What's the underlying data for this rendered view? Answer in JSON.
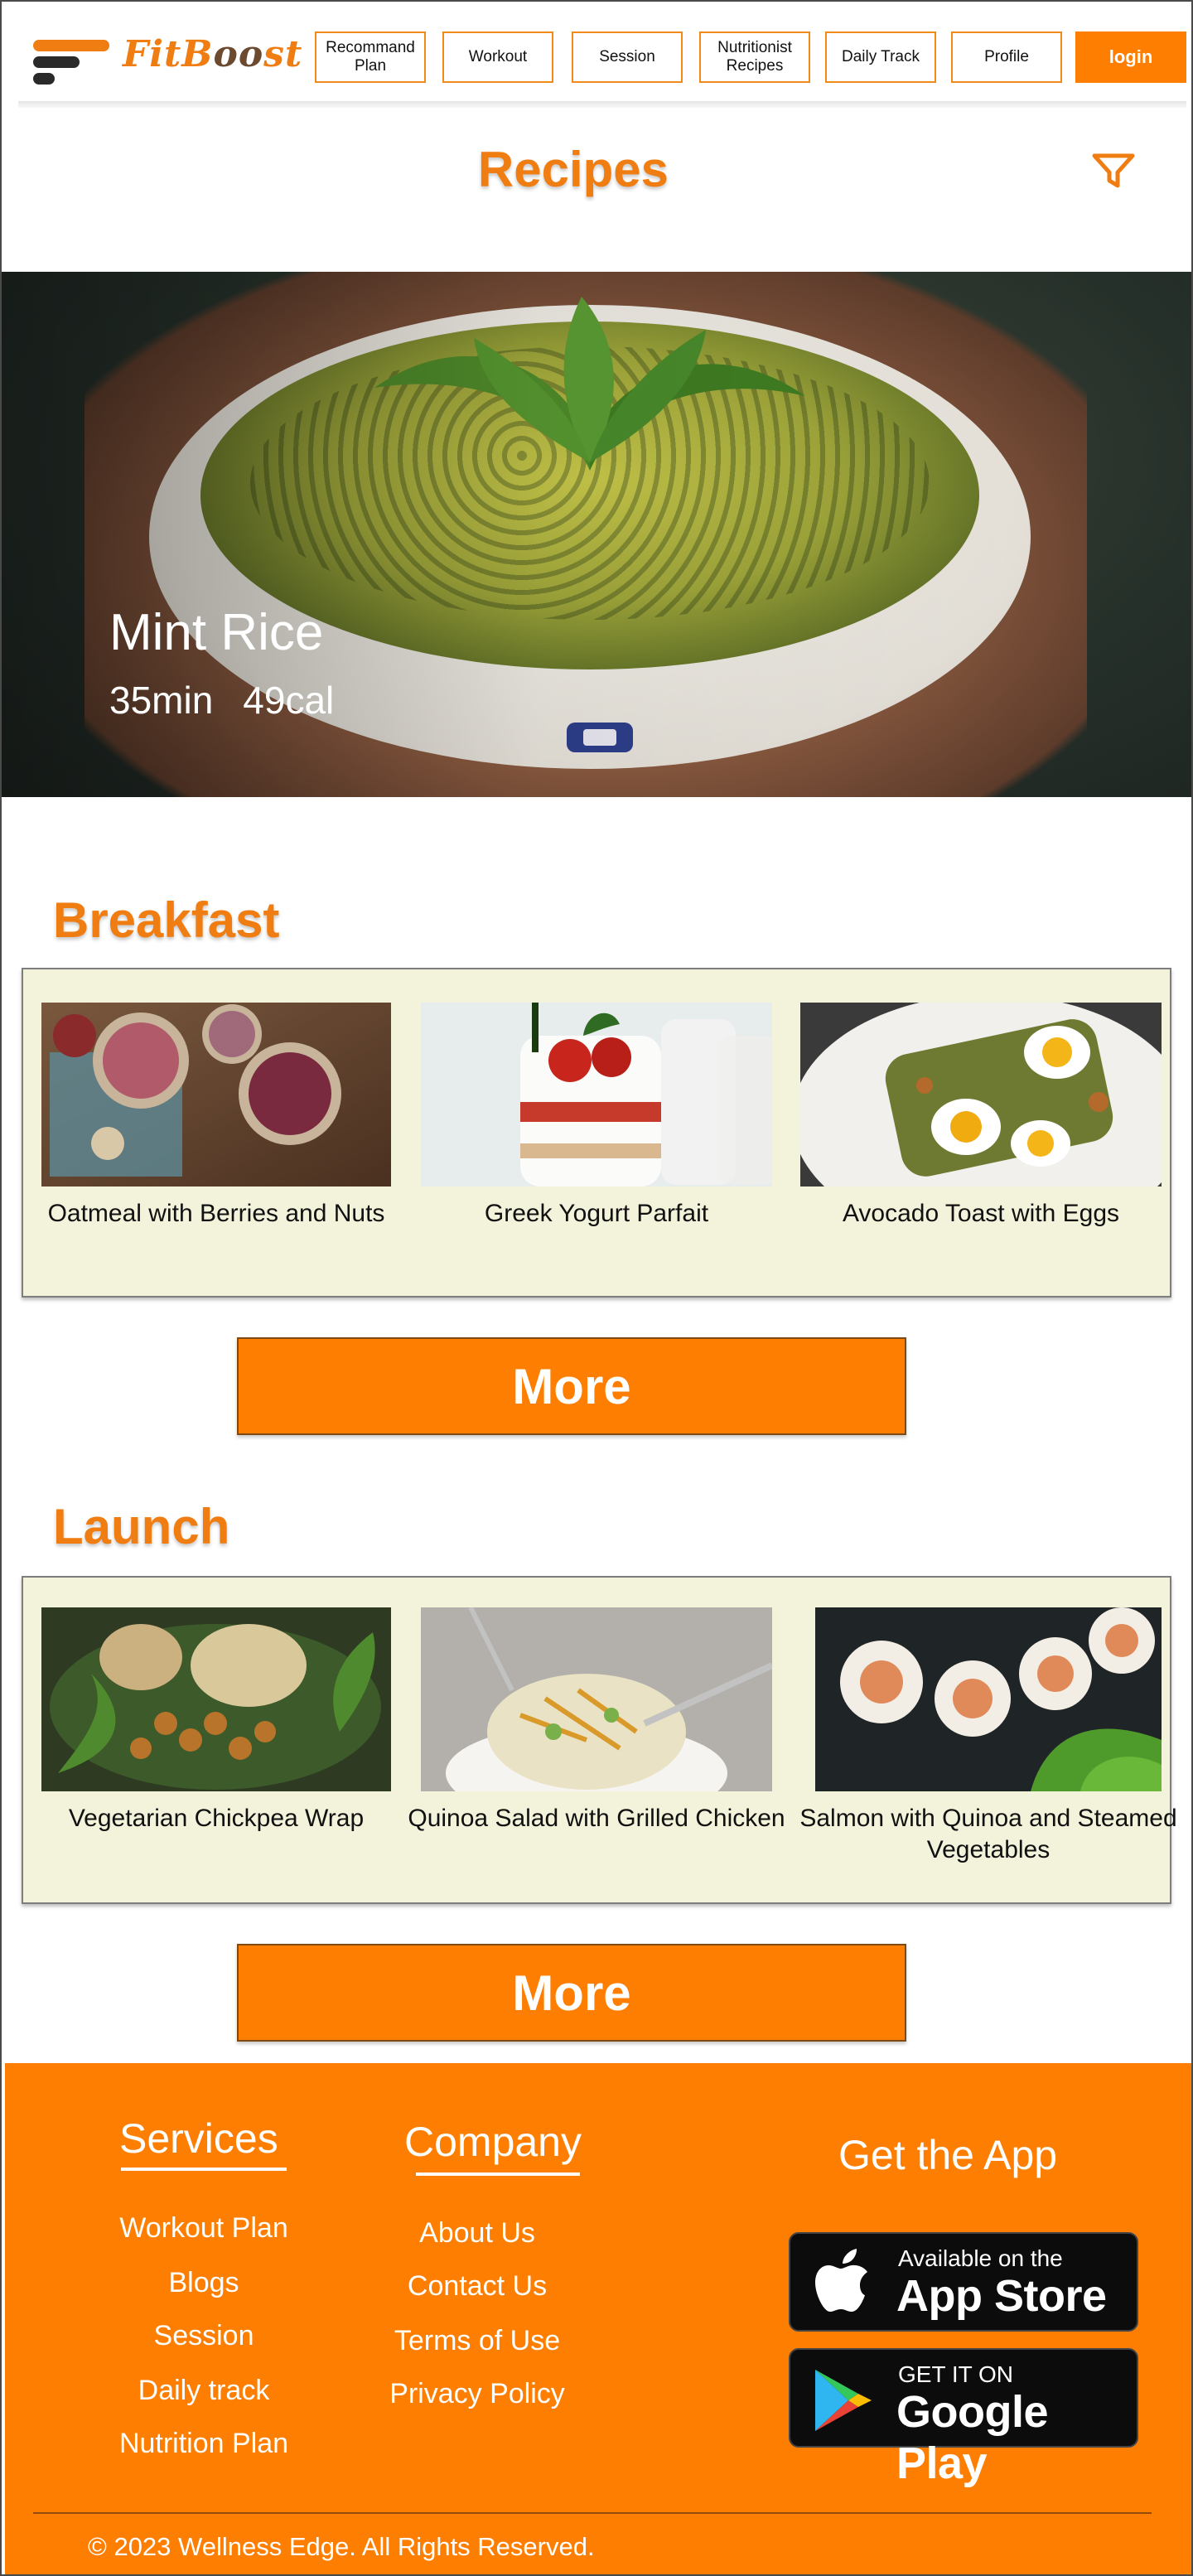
{
  "brand": {
    "name_part1": "FitB",
    "name_part2": "oo",
    "name_part3": "st"
  },
  "nav": {
    "items": [
      {
        "line1": "Recommand",
        "line2": "Plan"
      },
      {
        "line1": "Workout",
        "line2": ""
      },
      {
        "line1": "Session",
        "line2": ""
      },
      {
        "line1": "Nutritionist",
        "line2": "Recipes"
      },
      {
        "line1": "Daily Track",
        "line2": ""
      },
      {
        "line1": "Profile",
        "line2": ""
      }
    ],
    "login_label": "login"
  },
  "page": {
    "title": "Recipes"
  },
  "hero": {
    "name": "Mint Rice",
    "time": "35min",
    "calories": "49cal"
  },
  "sections": [
    {
      "title": "Breakfast",
      "items": [
        {
          "label": "Oatmeal with Berries and Nuts",
          "image": "oatmeal-berries-image"
        },
        {
          "label": "Greek Yogurt Parfait",
          "image": "yogurt-parfait-image"
        },
        {
          "label": "Avocado Toast with Eggs",
          "image": "avocado-toast-image"
        }
      ],
      "more_label": "More"
    },
    {
      "title": "Launch",
      "items": [
        {
          "label": "Vegetarian Chickpea Wrap",
          "image": "chickpea-wrap-image"
        },
        {
          "label": "Quinoa Salad with Grilled Chicken",
          "image": "quinoa-salad-image"
        },
        {
          "label": "Salmon with Quinoa and Steamed Vegetables",
          "image": "salmon-quinoa-image"
        }
      ],
      "more_label": "More"
    }
  ],
  "footer": {
    "services": {
      "heading": "Services",
      "links": [
        "Workout Plan",
        "Blogs",
        "Session",
        "Daily track",
        "Nutrition Plan"
      ]
    },
    "company": {
      "heading": "Company",
      "links": [
        "About Us",
        "Contact Us",
        "Terms of Use",
        "Privacy Policy"
      ]
    },
    "app": {
      "heading": "Get the App",
      "app_store_small": "Available on the",
      "app_store_big": "App Store",
      "google_small": "GET IT ON",
      "google_big": "Google Play"
    },
    "copyright": "© 2023 Wellness Edge. All Rights Reserved."
  },
  "colors": {
    "accent": "#fd7e00",
    "title": "#f07d12",
    "panel": "#f3f2db"
  },
  "icons": [
    "filter-icon",
    "apple-icon",
    "google-play-icon",
    "logo-bars-icon"
  ]
}
